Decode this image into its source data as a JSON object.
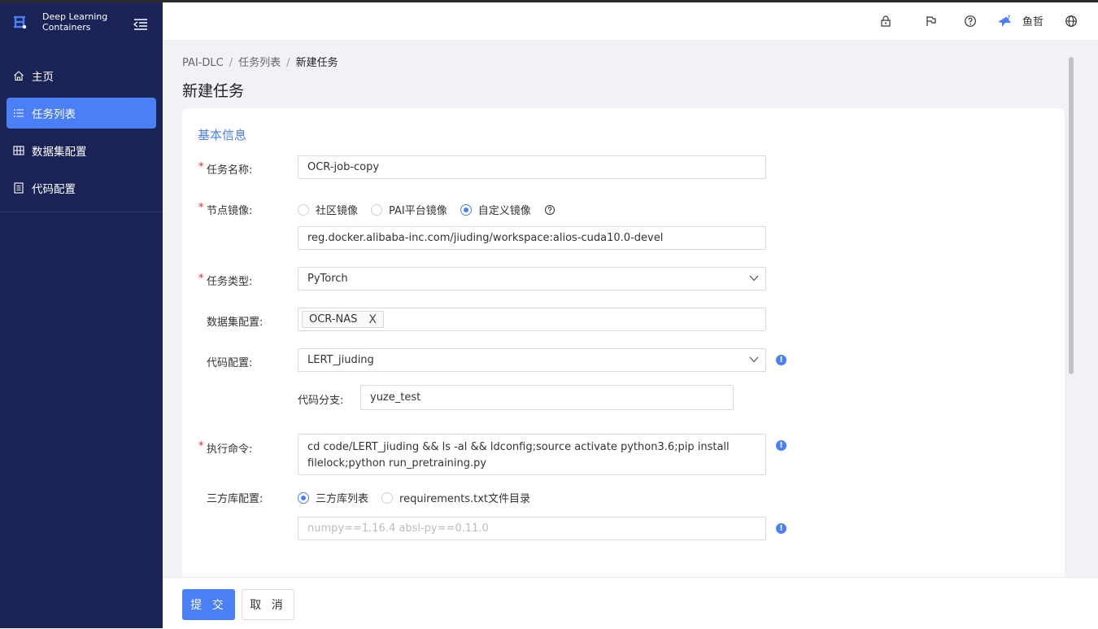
{
  "app": {
    "brand_line1": "Deep Learning",
    "brand_line2": "Containers"
  },
  "sidebar": {
    "items": [
      {
        "label": "主页",
        "icon": "home-icon"
      },
      {
        "label": "任务列表",
        "icon": "list-icon",
        "active": true
      },
      {
        "label": "数据集配置",
        "icon": "table-icon"
      },
      {
        "label": "代码配置",
        "icon": "file-icon"
      }
    ]
  },
  "header": {
    "user_name": "鱼哲",
    "icons": [
      "lock-icon",
      "flag-icon",
      "help-icon",
      "avatar",
      "globe-icon"
    ]
  },
  "breadcrumb": {
    "items": [
      "PAI-DLC",
      "任务列表",
      "新建任务"
    ]
  },
  "page": {
    "title": "新建任务",
    "section_title": "基本信息"
  },
  "form": {
    "task_name": {
      "label": "任务名称:",
      "value": "OCR-job-copy"
    },
    "node_image": {
      "label": "节点镜像:",
      "options": [
        "社区镜像",
        "PAI平台镜像",
        "自定义镜像"
      ],
      "selected": "自定义镜像",
      "value": "reg.docker.alibaba-inc.com/jiuding/workspace:alios-cuda10.0-devel"
    },
    "task_type": {
      "label": "任务类型:",
      "value": "PyTorch"
    },
    "dataset": {
      "label": "数据集配置:",
      "tag": "OCR-NAS",
      "tag_close": "X"
    },
    "code": {
      "label": "代码配置:",
      "value": "LERT_jiuding"
    },
    "code_branch": {
      "label": "代码分支:",
      "value": "yuze_test"
    },
    "command": {
      "label": "执行命令:",
      "value": "cd code/LERT_jiuding && ls -al && ldconfig;source activate python3.6;pip install filelock;python run_pretraining.py"
    },
    "third_party": {
      "label": "三方库配置:",
      "options": [
        "三方库列表",
        "requirements.txt文件目录"
      ],
      "selected": "三方库列表",
      "placeholder": "numpy==1.16.4   absl-py==0.11.0"
    }
  },
  "footer": {
    "submit_label": "提 交",
    "cancel_label": "取 消"
  },
  "colors": {
    "sidebar_bg": "#1b2256",
    "accent": "#4a7ff5",
    "required": "#f5222d"
  }
}
